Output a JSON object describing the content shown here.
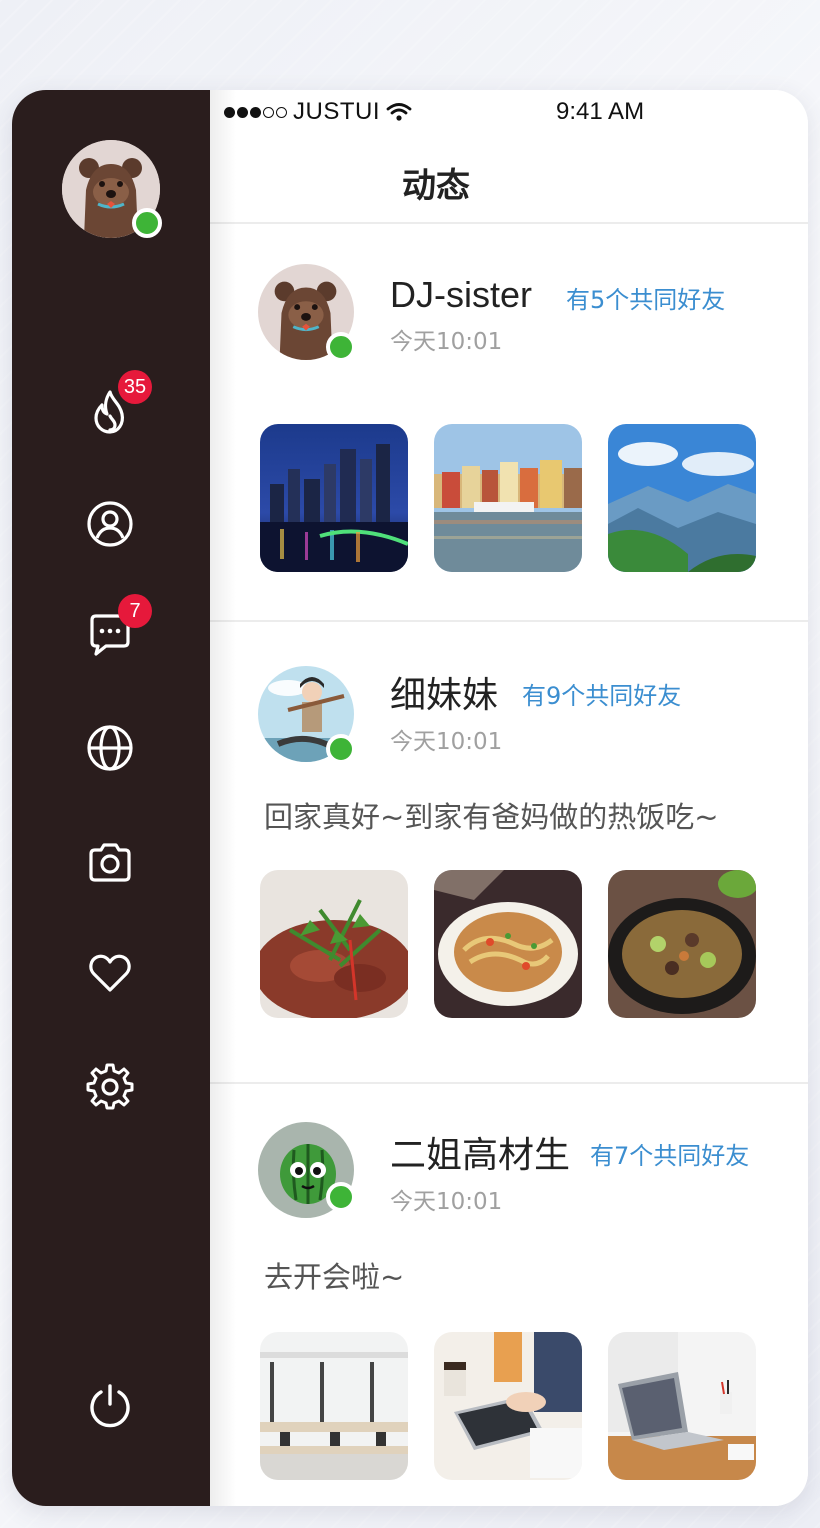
{
  "status_bar": {
    "carrier": "JUSTUI",
    "time": "9:41 AM"
  },
  "page_title": "动态",
  "sidebar": {
    "items": [
      {
        "name": "hot",
        "icon": "flame-icon",
        "badge": "35"
      },
      {
        "name": "profile",
        "icon": "user-icon",
        "badge": null
      },
      {
        "name": "messages",
        "icon": "chat-icon",
        "badge": "7"
      },
      {
        "name": "explore",
        "icon": "globe-icon",
        "badge": null
      },
      {
        "name": "camera",
        "icon": "camera-icon",
        "badge": null
      },
      {
        "name": "favorites",
        "icon": "heart-icon",
        "badge": null
      },
      {
        "name": "settings",
        "icon": "gear-icon",
        "badge": null
      }
    ],
    "power_icon": "power-icon"
  },
  "posts": [
    {
      "name": "DJ-sister",
      "mutual": "有5个共同好友",
      "time": "今天10:01",
      "text": "",
      "avatar": "bear-avatar",
      "photos": [
        "city-night-photo",
        "harbor-photo",
        "mountain-photo"
      ]
    },
    {
      "name": "细妹妹",
      "mutual": "有9个共同好友",
      "time": "今天10:01",
      "text": "回家真好~到家有爸妈做的热饭吃~",
      "avatar": "traveler-avatar",
      "photos": [
        "beef-dish-photo",
        "noodle-dish-photo",
        "stew-pot-photo"
      ]
    },
    {
      "name": "二姐高材生",
      "mutual": "有7个共同好友",
      "time": "今天10:01",
      "text": "去开会啦~",
      "avatar": "watermelon-avatar",
      "photos": [
        "office-photo",
        "laptop-writing-photo",
        "laptop-desk-photo"
      ]
    }
  ],
  "colors": {
    "sidebar_bg": "#2a1d1d",
    "online": "#3eb437",
    "badge": "#e6193b",
    "mutual_link": "#3b8ed0"
  }
}
